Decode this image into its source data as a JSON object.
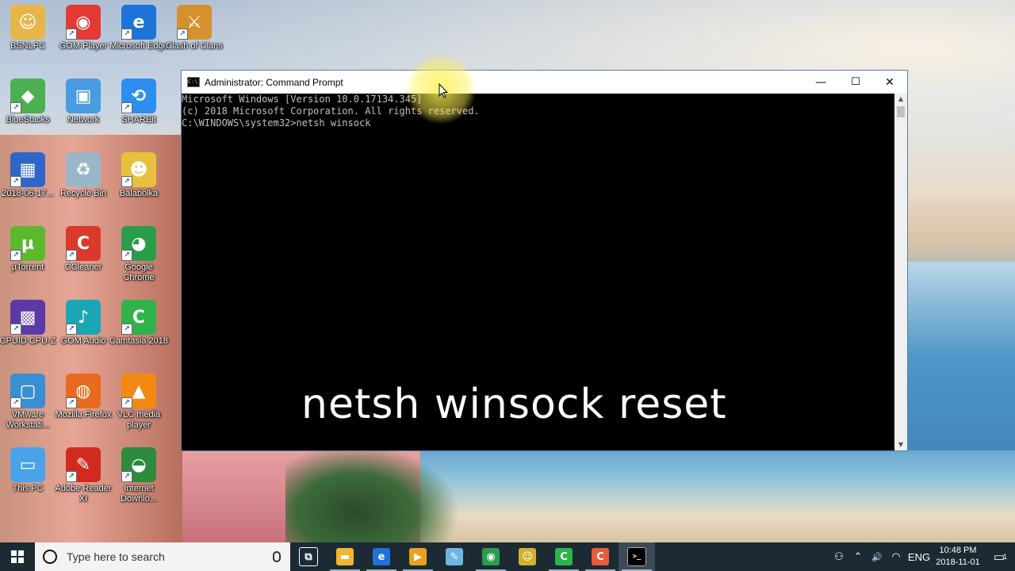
{
  "desktop_icons": [
    {
      "label": "BSNLPC",
      "icon": "user-folder-icon",
      "color": "#e7b64a"
    },
    {
      "label": "GOM Player",
      "icon": "gom-player-icon",
      "color": "#e53935"
    },
    {
      "label": "Microsoft Edge",
      "icon": "edge-icon",
      "color": "#1e73d8"
    },
    {
      "label": "Clash of Clans",
      "icon": "clash-of-clans-icon",
      "color": "#d4912d"
    },
    {
      "label": "BlueStacks",
      "icon": "bluestacks-icon",
      "color": "#4caf50"
    },
    {
      "label": "Network",
      "icon": "network-icon",
      "color": "#4a9be0"
    },
    {
      "label": "SHAREit",
      "icon": "shareit-icon",
      "color": "#2d8ef0"
    },
    {
      "label": "2018-06-17...",
      "icon": "video-file-icon",
      "color": "#2f66c9"
    },
    {
      "label": "Recycle Bin",
      "icon": "recycle-bin-icon",
      "color": "#9ab6c8"
    },
    {
      "label": "Balabolka",
      "icon": "balabolka-icon",
      "color": "#e8c13c"
    },
    {
      "label": "µTorrent",
      "icon": "utorrent-icon",
      "color": "#5cb82c"
    },
    {
      "label": "CCleaner",
      "icon": "ccleaner-icon",
      "color": "#d83a2c"
    },
    {
      "label": "Google Chrome",
      "icon": "chrome-icon",
      "color": "#2a9d4a"
    },
    {
      "label": "CPUID CPU-Z",
      "icon": "cpuz-icon",
      "color": "#5b3aa8"
    },
    {
      "label": "GOM Audio",
      "icon": "gom-audio-icon",
      "color": "#19a6b5"
    },
    {
      "label": "Camtasia 2018",
      "icon": "camtasia-icon",
      "color": "#2fb34a"
    },
    {
      "label": "VMware Workstati...",
      "icon": "vmware-icon",
      "color": "#3a8fd3"
    },
    {
      "label": "Mozilla Firefox",
      "icon": "firefox-icon",
      "color": "#e86a1e"
    },
    {
      "label": "VLC media player",
      "icon": "vlc-icon",
      "color": "#f28a12"
    },
    {
      "label": "This PC",
      "icon": "this-pc-icon",
      "color": "#4aa3e8"
    },
    {
      "label": "Adobe Reader XI",
      "icon": "adobe-reader-icon",
      "color": "#d32a1f"
    },
    {
      "label": "Internet Downlo...",
      "icon": "idm-icon",
      "color": "#2e8b3e"
    }
  ],
  "cmd_window": {
    "title": "Administrator: Command Prompt",
    "icon_glyph": "C:\\",
    "minimize": "—",
    "maximize": "☐",
    "close": "✕",
    "lines": [
      "Microsoft Windows [Version 10.0.17134.345]",
      "(c) 2018 Microsoft Corporation. All rights reserved.",
      "",
      "C:\\WINDOWS\\system32>netsh winsock"
    ]
  },
  "caption": "netsh winsock reset",
  "taskbar": {
    "search_placeholder": "Type here to search",
    "apps": [
      {
        "name": "task-view",
        "glyph": "⧉",
        "color": "transparent"
      },
      {
        "name": "file-explorer",
        "glyph": "▬",
        "color": "#f2b632"
      },
      {
        "name": "edge",
        "glyph": "e",
        "color": "#1e73d8"
      },
      {
        "name": "media-player",
        "glyph": "▶",
        "color": "#e8a020"
      },
      {
        "name": "notepad",
        "glyph": "✎",
        "color": "#6fb5e0"
      },
      {
        "name": "chrome",
        "glyph": "◉",
        "color": "#2a9d4a"
      },
      {
        "name": "balabolka",
        "glyph": "☺",
        "color": "#d4b030"
      },
      {
        "name": "camtasia",
        "glyph": "C",
        "color": "#2fb34a"
      },
      {
        "name": "camtasia-recorder",
        "glyph": "C",
        "color": "#e85a3a"
      },
      {
        "name": "command-prompt",
        "glyph": ">_",
        "color": "#000000"
      }
    ],
    "tray": {
      "people": "⚇",
      "chevron": "⌃",
      "volume": "🔊",
      "wifi": "◠",
      "language": "ENG",
      "time": "10:48 PM",
      "date": "2018-11-01",
      "notifications": "▭",
      "notification_count": "1"
    }
  }
}
